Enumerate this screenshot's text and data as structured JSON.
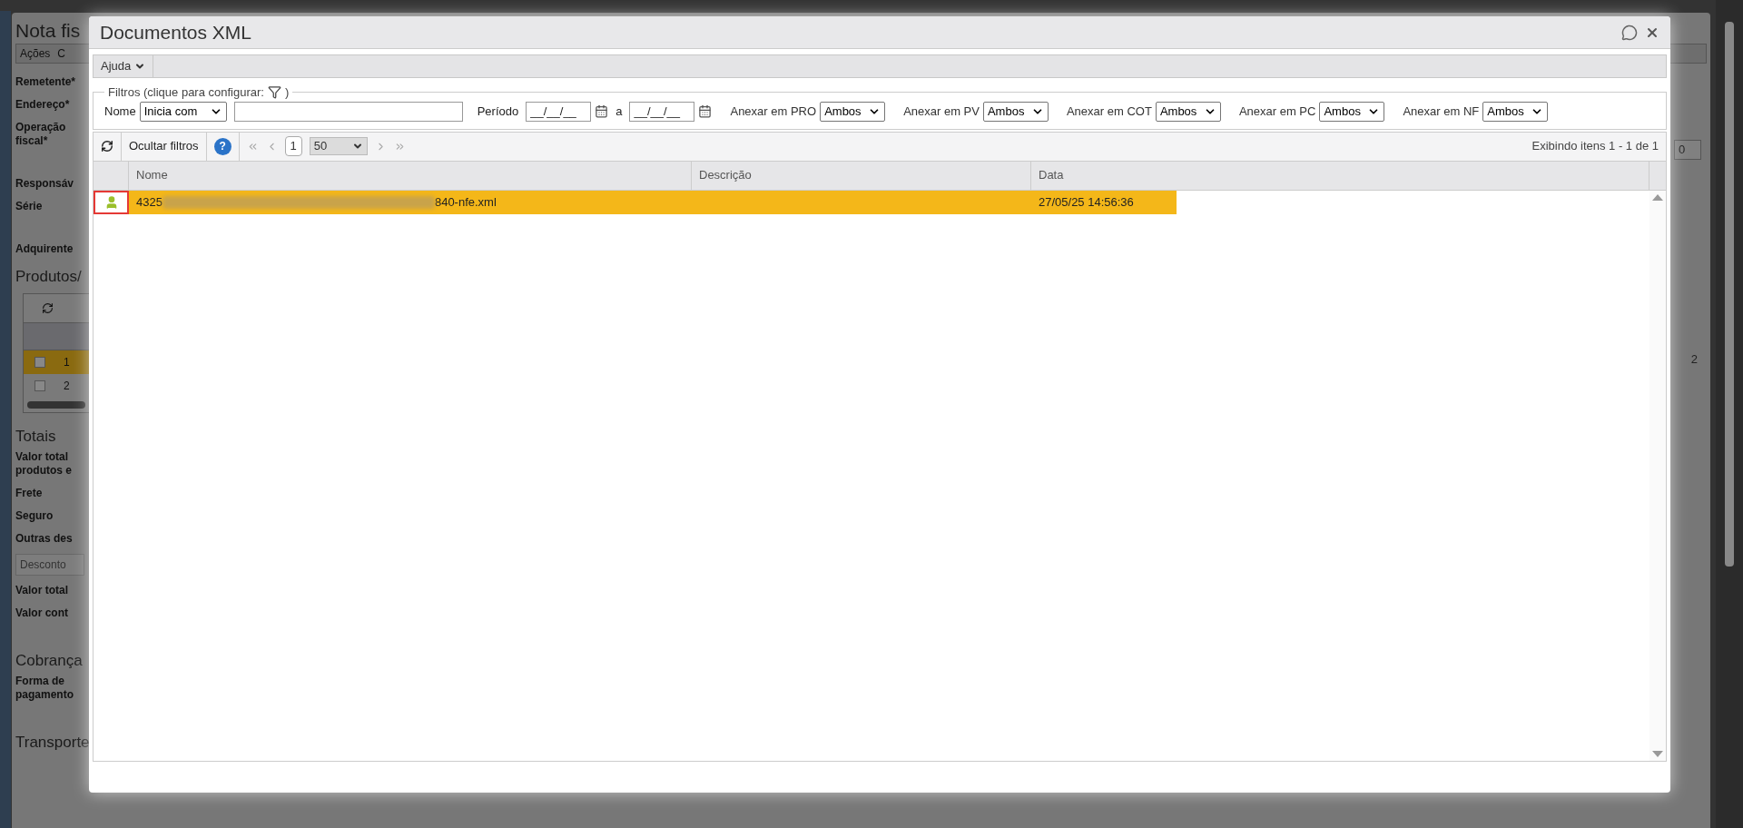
{
  "background": {
    "title": "Nota fis",
    "menu": [
      "Ações",
      "C"
    ],
    "form": [
      {
        "kind": "label",
        "text": "Remetente*"
      },
      {
        "kind": "label",
        "text": "Endereço*"
      },
      {
        "kind": "label",
        "text": "Operação fiscal*"
      },
      {
        "kind": "gap"
      },
      {
        "kind": "label",
        "text": "Responsáv"
      },
      {
        "kind": "label",
        "text": "Série"
      },
      {
        "kind": "gap"
      },
      {
        "kind": "label",
        "text": "Adquirente"
      },
      {
        "kind": "section",
        "text": "Produtos/"
      },
      {
        "kind": "grid",
        "rows": [
          {
            "number": "1",
            "selected": true
          },
          {
            "number": "2",
            "selected": false
          }
        ]
      },
      {
        "kind": "section",
        "text": "Totais"
      },
      {
        "kind": "label",
        "text": "Valor total produtos e"
      },
      {
        "kind": "label",
        "text": "Frete"
      },
      {
        "kind": "label",
        "text": "Seguro"
      },
      {
        "kind": "label",
        "text": "Outras des"
      },
      {
        "kind": "field",
        "text": "Desconto"
      },
      {
        "kind": "label",
        "text": "Valor total"
      },
      {
        "kind": "label",
        "text": "Valor cont"
      },
      {
        "kind": "gap"
      },
      {
        "kind": "section",
        "text": "Cobrança"
      },
      {
        "kind": "label",
        "text": "Forma de pagamento"
      },
      {
        "kind": "gap"
      },
      {
        "kind": "section",
        "text": "Transporte"
      }
    ],
    "right_field": "0",
    "right_count": "2"
  },
  "dialog": {
    "title": "Documentos XML",
    "menu": [
      "Ajuda"
    ],
    "filters": {
      "legend": "Filtros (clique para configurar:",
      "legend_end": ")",
      "name_label": "Nome",
      "name_operator": "Inicia com",
      "period_label": "Período",
      "period_from": "__/__/__",
      "period_separator": "a",
      "period_to": "__/__/__",
      "attach": [
        {
          "label": "Anexar em PRO",
          "value": "Ambos"
        },
        {
          "label": "Anexar em PV",
          "value": "Ambos"
        },
        {
          "label": "Anexar em COT",
          "value": "Ambos"
        },
        {
          "label": "Anexar em PC",
          "value": "Ambos"
        },
        {
          "label": "Anexar em NF",
          "value": "Ambos"
        }
      ]
    },
    "toolbar": {
      "help": "?",
      "hide_filters": "Ocultar filtros",
      "page": "1",
      "page_size": "50",
      "status": "Exibindo itens 1 - 1 de 1"
    },
    "columns": [
      "Nome",
      "Descrição",
      "Data"
    ],
    "rows": [
      {
        "name_start": "4325",
        "name_end": "840-nfe.xml",
        "date": "27/05/25 14:56:36",
        "selected": true,
        "highlighted": true
      }
    ]
  }
}
